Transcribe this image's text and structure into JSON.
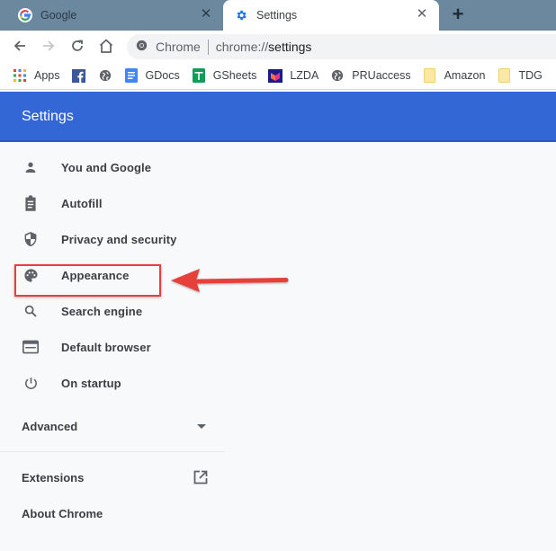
{
  "tabs": [
    {
      "title": "Google",
      "icon": "google-g-icon",
      "active": false
    },
    {
      "title": "Settings",
      "icon": "gear-icon",
      "active": true
    }
  ],
  "toolbar": {
    "back": "arrow-left-icon",
    "forward": "arrow-right-icon",
    "reload": "reload-icon",
    "home": "home-icon",
    "omnibox": {
      "site_label": "Chrome",
      "url_scheme": "chrome://",
      "url_host": "settings"
    }
  },
  "bookmarks": [
    {
      "label": "Apps",
      "icon": "apps-grid-icon"
    },
    {
      "label": "",
      "icon": "facebook-icon"
    },
    {
      "label": "",
      "icon": "globe-icon"
    },
    {
      "label": "GDocs",
      "icon": "google-docs-icon"
    },
    {
      "label": "GSheets",
      "icon": "google-sheets-icon"
    },
    {
      "label": "LZDA",
      "icon": "lazada-icon"
    },
    {
      "label": "PRUaccess",
      "icon": "globe-icon"
    },
    {
      "label": "Amazon",
      "icon": "folder-icon"
    },
    {
      "label": "TDG",
      "icon": "folder-icon"
    }
  ],
  "header": {
    "title": "Settings"
  },
  "colors": {
    "header_bg": "#3367d6",
    "tabstrip_bg": "#6b889f",
    "annotation_red": "#e6403b"
  },
  "sidebar": {
    "items": [
      {
        "label": "You and Google",
        "icon": "person-icon"
      },
      {
        "label": "Autofill",
        "icon": "clipboard-icon"
      },
      {
        "label": "Privacy and security",
        "icon": "shield-icon"
      },
      {
        "label": "Appearance",
        "icon": "palette-icon",
        "highlighted": true
      },
      {
        "label": "Search engine",
        "icon": "search-icon"
      },
      {
        "label": "Default browser",
        "icon": "browser-window-icon"
      },
      {
        "label": "On startup",
        "icon": "power-icon"
      }
    ],
    "advanced": {
      "label": "Advanced",
      "icon": "caret-down-icon"
    },
    "extensions": {
      "label": "Extensions",
      "icon": "open-in-new-icon"
    },
    "about": {
      "label": "About Chrome"
    }
  },
  "annotation": {
    "type": "arrow",
    "points_to": "Appearance"
  }
}
